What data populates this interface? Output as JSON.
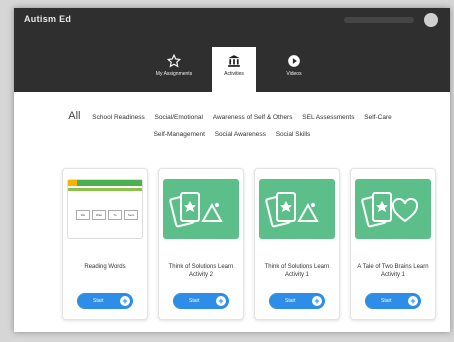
{
  "app": {
    "brand": "Autism Ed"
  },
  "nav": {
    "tabs": [
      {
        "label": "My Assignments",
        "icon": "star-outline-icon",
        "active": false
      },
      {
        "label": "Activities",
        "icon": "bank-building-icon",
        "active": true
      },
      {
        "label": "Videos",
        "icon": "play-circle-icon",
        "active": false
      }
    ]
  },
  "filters": {
    "all": "All",
    "items": [
      "School Readiness",
      "Social/Emotional",
      "Awareness of Self & Others",
      "SEL Assessments",
      "Self-Care",
      "Self-Management",
      "Social Awareness",
      "Social Skills"
    ]
  },
  "cards": [
    {
      "title": "Reading Words",
      "button": "Start"
    },
    {
      "title": "Think of Solutions Learn Activity 2",
      "button": "Start"
    },
    {
      "title": "Think of Solutions Learn Activity 1",
      "button": "Start"
    },
    {
      "title": "A Tale of Two Brains Learn Activity 1",
      "button": "Start"
    }
  ],
  "reading_words_thumb": {
    "chips": [
      "We",
      "Was",
      "To",
      "Sent"
    ]
  },
  "colors": {
    "topbar": "#2f2f2f",
    "card_thumb": "#5cbf8a",
    "button": "#2e8de8"
  }
}
